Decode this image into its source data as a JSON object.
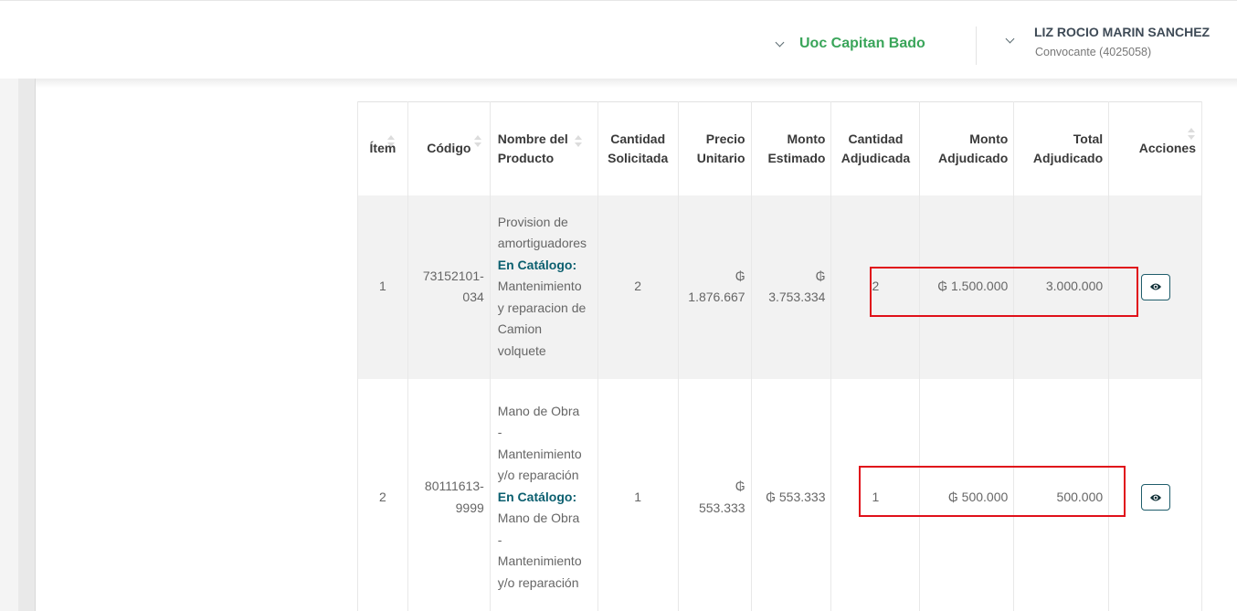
{
  "header": {
    "uoc_label": "Uoc Capitan Bado",
    "user_name": "LIZ ROCIO MARIN SANCHEZ",
    "user_role": "Convocante (4025058)"
  },
  "table": {
    "headers": {
      "item": "Ítem",
      "codigo": "Código",
      "nombre_l1": "Nombre del",
      "nombre_l2": "Producto",
      "cant_sol_l1": "Cantidad",
      "cant_sol_l2": "Solicitada",
      "precio_l1": "Precio",
      "precio_l2": "Unitario",
      "monto_est_l1": "Monto",
      "monto_est_l2": "Estimado",
      "cant_adj_l1": "Cantidad",
      "cant_adj_l2": "Adjudicada",
      "monto_adj_l1": "Monto",
      "monto_adj_l2": "Adjudicado",
      "total_adj_l1": "Total",
      "total_adj_l2": "Adjudicado",
      "acciones": "Acciones"
    },
    "rows": [
      {
        "item": "1",
        "codigo_l1": "73152101-",
        "codigo_l2": "034",
        "nombre_lines": [
          "Provision de",
          "amortiguadores"
        ],
        "catalogo_label": "En Catálogo:",
        "catalogo_lines": [
          "Mantenimiento",
          "y reparacion de",
          "Camion",
          "volquete"
        ],
        "cantidad_solicitada": "2",
        "precio_l1": "₲",
        "precio_l2": "1.876.667",
        "monto_est_l1": "₲",
        "monto_est_l2": "3.753.334",
        "cantidad_adjudicada": "2",
        "monto_adjudicado": "₲ 1.500.000",
        "total_adjudicado": "3.000.000"
      },
      {
        "item": "2",
        "codigo_l1": "80111613-",
        "codigo_l2": "9999",
        "nombre_lines": [
          "Mano de Obra",
          "-",
          "Mantenimiento",
          "y/o reparación"
        ],
        "catalogo_label": "En Catálogo:",
        "catalogo_lines": [
          "Mano de Obra",
          "-",
          "Mantenimiento",
          "y/o reparación"
        ],
        "cantidad_solicitada": "1",
        "precio_l1": "₲",
        "precio_l2": "553.333",
        "monto_estimado": "₲ 553.333",
        "cantidad_adjudicada": "1",
        "monto_adjudicado": "₲ 500.000",
        "total_adjudicado": "500.000"
      }
    ]
  },
  "colors": {
    "uoc_green": "#3aa55a",
    "catalog_teal": "#0b5f6f",
    "highlight_red": "#e0101a",
    "row_shade": "#f2f2f2"
  },
  "icons": [
    "chevron-down-icon",
    "sort-icon",
    "eye-icon"
  ]
}
